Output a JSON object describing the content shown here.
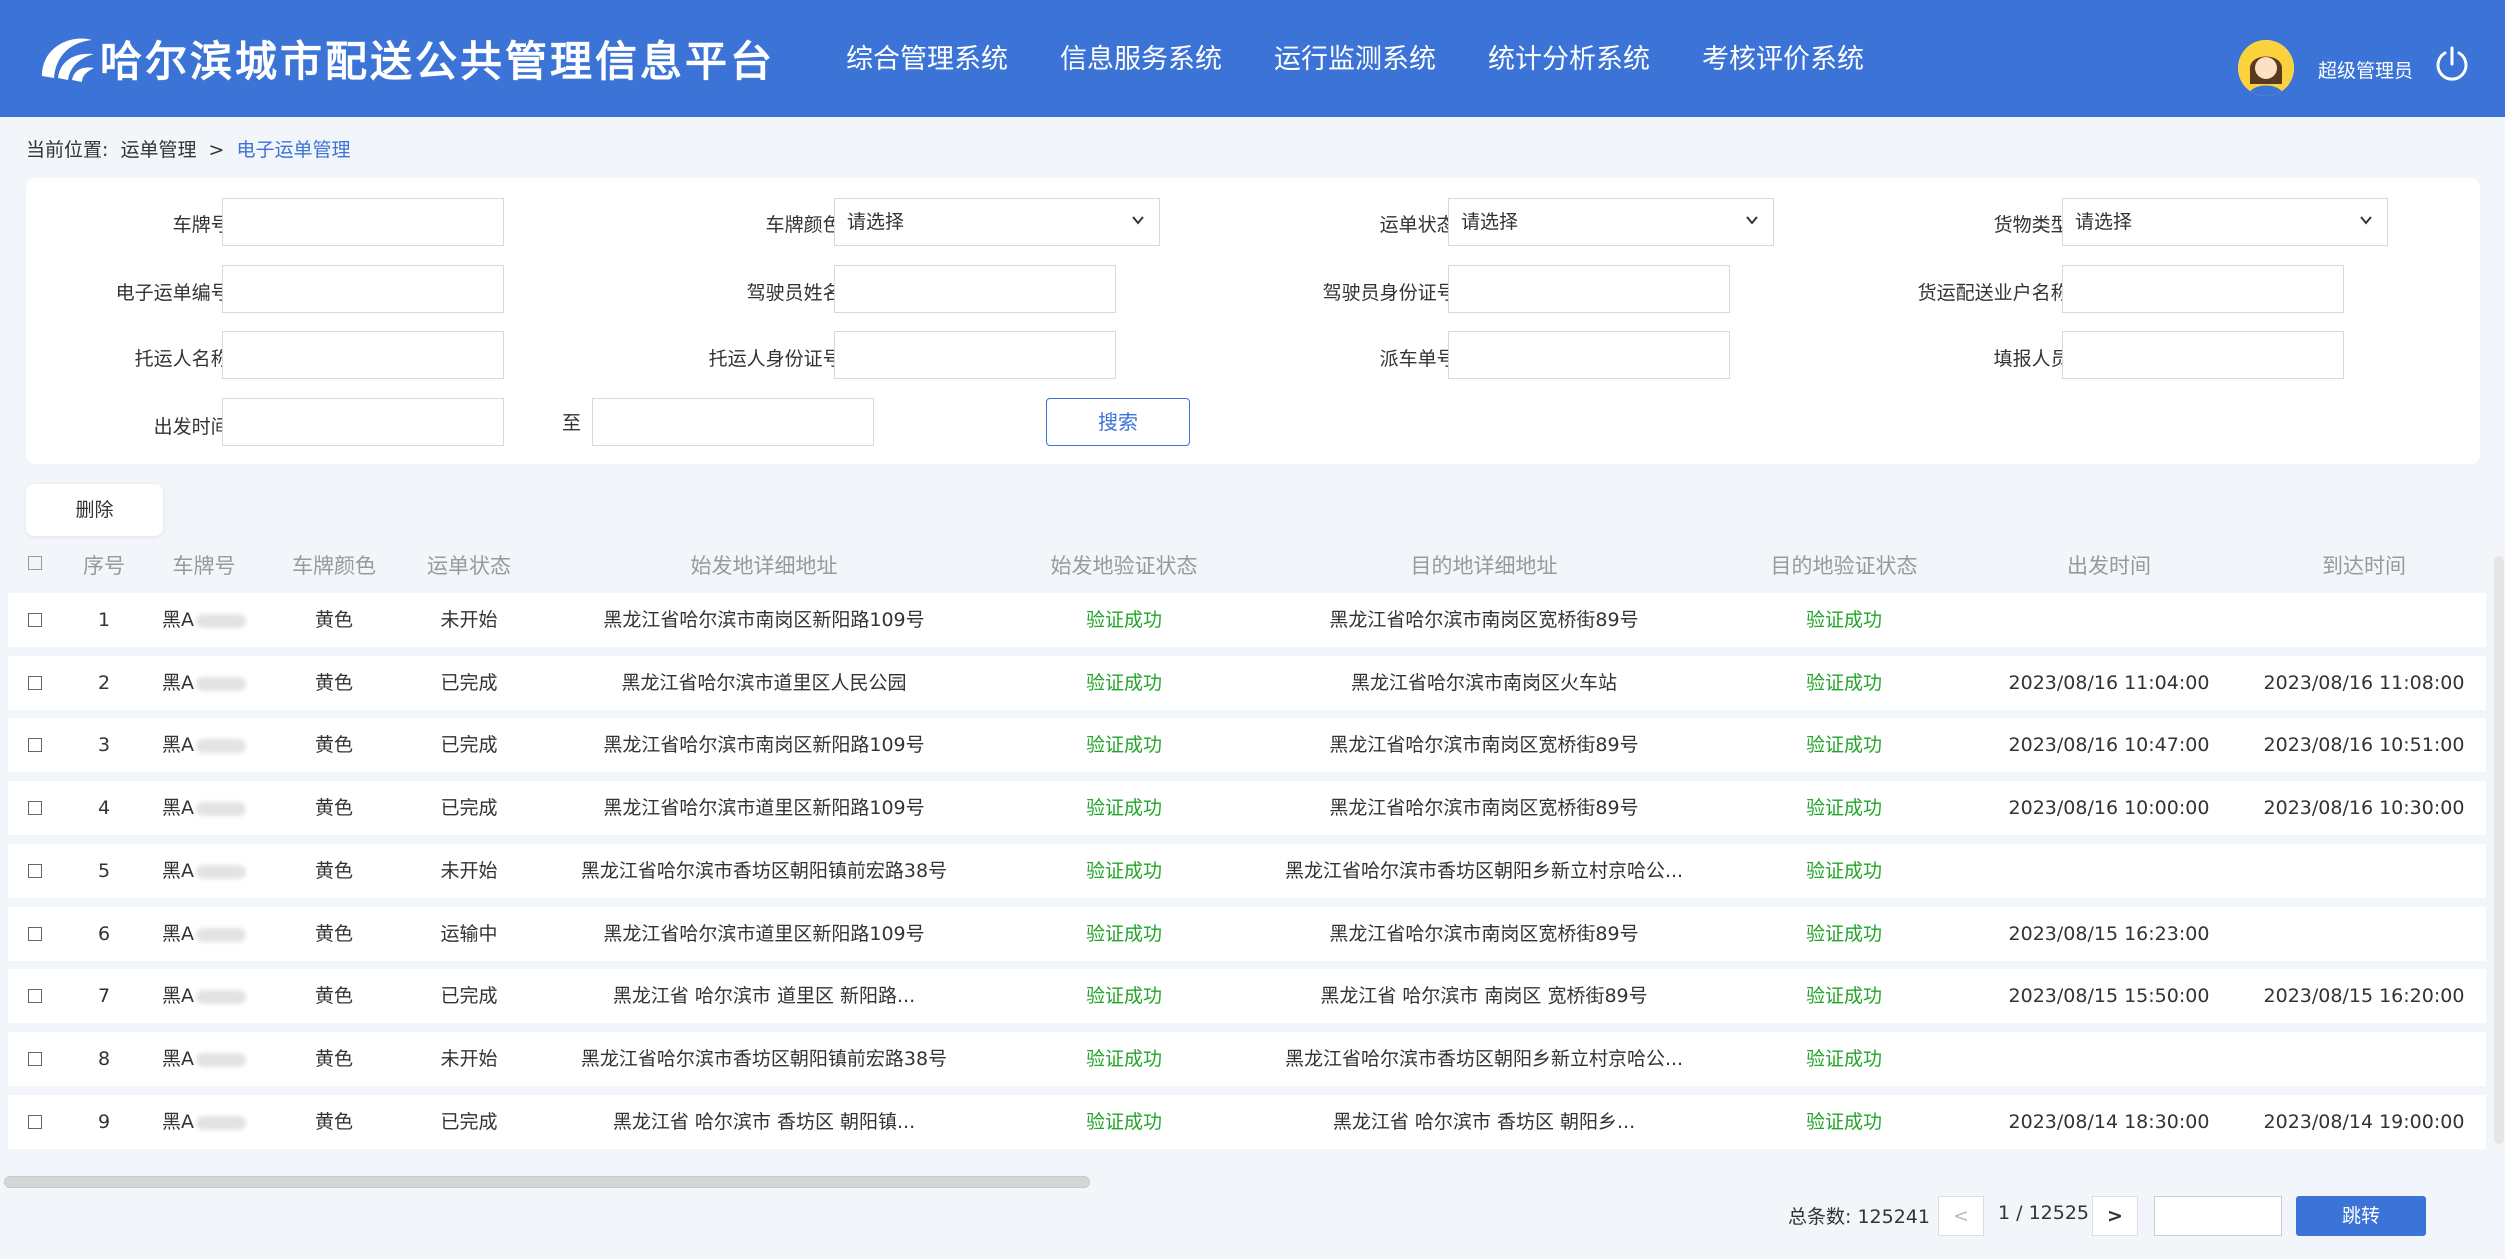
{
  "header": {
    "title": "哈尔滨城市配送公共管理信息平台",
    "nav": [
      "综合管理系统",
      "信息服务系统",
      "运行监测系统",
      "统计分析系统",
      "考核评价系统"
    ],
    "user_name": "超级管理员"
  },
  "breadcrumb": {
    "prefix": "当前位置:",
    "parent": "运单管理",
    "separator": ">",
    "current": "电子运单管理"
  },
  "filters": {
    "plate_number": "车牌号:",
    "plate_color": "车牌颜色:",
    "waybill_status": "运单状态:",
    "cargo_type": "货物类型:",
    "waybill_no": "电子运单编号:",
    "driver_name": "驾驶员姓名:",
    "driver_id": "驾驶员身份证号:",
    "carrier_name": "货运配送业户名称:",
    "shipper_name": "托运人名称:",
    "shipper_id": "托运人身份证号:",
    "dispatch_no": "派车单号:",
    "reporter": "填报人员:",
    "depart_time": "出发时间:",
    "to": "至",
    "select_placeholder": "请选择",
    "search_label": "搜索"
  },
  "actions": {
    "delete_label": "删除"
  },
  "table": {
    "columns": [
      "序号",
      "车牌号",
      "车牌颜色",
      "运单状态",
      "始发地详细地址",
      "始发地验证状态",
      "目的地详细地址",
      "目的地验证状态",
      "出发时间",
      "到达时间"
    ],
    "rows": [
      {
        "no": "1",
        "plate": "黑A",
        "color": "黄色",
        "status": "未开始",
        "origin": "黑龙江省哈尔滨市南岗区新阳路109号",
        "origin_check": "验证成功",
        "dest": "黑龙江省哈尔滨市南岗区宽桥街89号",
        "dest_check": "验证成功",
        "depart": "",
        "arrive": ""
      },
      {
        "no": "2",
        "plate": "黑A",
        "color": "黄色",
        "status": "已完成",
        "origin": "黑龙江省哈尔滨市道里区人民公园",
        "origin_check": "验证成功",
        "dest": "黑龙江省哈尔滨市南岗区火车站",
        "dest_check": "验证成功",
        "depart": "2023/08/16 11:04:00",
        "arrive": "2023/08/16 11:08:00"
      },
      {
        "no": "3",
        "plate": "黑A",
        "color": "黄色",
        "status": "已完成",
        "origin": "黑龙江省哈尔滨市南岗区新阳路109号",
        "origin_check": "验证成功",
        "dest": "黑龙江省哈尔滨市南岗区宽桥街89号",
        "dest_check": "验证成功",
        "depart": "2023/08/16 10:47:00",
        "arrive": "2023/08/16 10:51:00"
      },
      {
        "no": "4",
        "plate": "黑A",
        "color": "黄色",
        "status": "已完成",
        "origin": "黑龙江省哈尔滨市道里区新阳路109号",
        "origin_check": "验证成功",
        "dest": "黑龙江省哈尔滨市南岗区宽桥街89号",
        "dest_check": "验证成功",
        "depart": "2023/08/16 10:00:00",
        "arrive": "2023/08/16 10:30:00"
      },
      {
        "no": "5",
        "plate": "黑A",
        "color": "黄色",
        "status": "未开始",
        "origin": "黑龙江省哈尔滨市香坊区朝阳镇前宏路38号",
        "origin_check": "验证成功",
        "dest": "黑龙江省哈尔滨市香坊区朝阳乡新立村京哈公...",
        "dest_check": "验证成功",
        "depart": "",
        "arrive": ""
      },
      {
        "no": "6",
        "plate": "黑A",
        "color": "黄色",
        "status": "运输中",
        "origin": "黑龙江省哈尔滨市道里区新阳路109号",
        "origin_check": "验证成功",
        "dest": "黑龙江省哈尔滨市南岗区宽桥街89号",
        "dest_check": "验证成功",
        "depart": "2023/08/15 16:23:00",
        "arrive": ""
      },
      {
        "no": "7",
        "plate": "黑A",
        "color": "黄色",
        "status": "已完成",
        "origin": "黑龙江省 哈尔滨市 道里区 新阳路...",
        "origin_check": "验证成功",
        "dest": "黑龙江省 哈尔滨市 南岗区 宽桥街89号",
        "dest_check": "验证成功",
        "depart": "2023/08/15 15:50:00",
        "arrive": "2023/08/15 16:20:00"
      },
      {
        "no": "8",
        "plate": "黑A",
        "color": "黄色",
        "status": "未开始",
        "origin": "黑龙江省哈尔滨市香坊区朝阳镇前宏路38号",
        "origin_check": "验证成功",
        "dest": "黑龙江省哈尔滨市香坊区朝阳乡新立村京哈公...",
        "dest_check": "验证成功",
        "depart": "",
        "arrive": ""
      },
      {
        "no": "9",
        "plate": "黑A",
        "color": "黄色",
        "status": "已完成",
        "origin": "黑龙江省 哈尔滨市 香坊区 朝阳镇...",
        "origin_check": "验证成功",
        "dest": "黑龙江省 哈尔滨市 香坊区 朝阳乡...",
        "dest_check": "验证成功",
        "depart": "2023/08/14 18:30:00",
        "arrive": "2023/08/14 19:00:00"
      }
    ]
  },
  "pagination": {
    "total_label": "总条数:",
    "total": "125241",
    "prev": "<",
    "page_info": "1 / 12525",
    "next": ">",
    "jump_label": "跳转"
  },
  "colors": {
    "primary": "#3b73d6",
    "success": "#22a52a"
  },
  "icons": {
    "logo": "harbin-logo-icon",
    "avatar": "user-avatar",
    "power": "power-icon",
    "chevron": "chevron-down-icon",
    "checkbox": "checkbox-icon"
  }
}
